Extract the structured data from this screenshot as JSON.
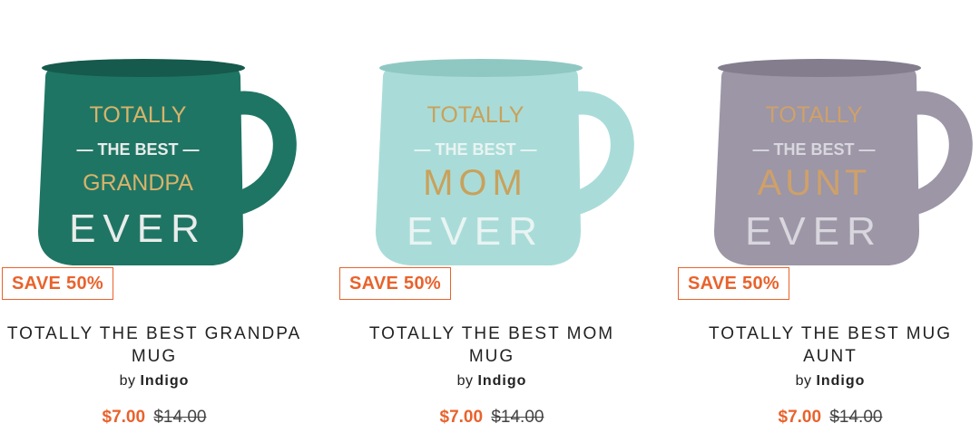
{
  "products": [
    {
      "badge": "SAVE 50%",
      "title_line1": "TOTALLY THE BEST GRANDPA",
      "title_line2": "MUG",
      "by": "by",
      "brand": "Indigo",
      "sale_price": "$7.00",
      "original_price": "$14.00",
      "mug": {
        "color": "#1f7564",
        "shade": "#155a4c",
        "words": [
          "TOTALLY",
          "— THE BEST —",
          "GRANDPA",
          "EVER"
        ],
        "accent": "#d9b36a",
        "light": "#e8ecea"
      }
    },
    {
      "badge": "SAVE 50%",
      "title_line1": "TOTALLY THE BEST MOM",
      "title_line2": "MUG",
      "by": "by",
      "brand": "Indigo",
      "sale_price": "$7.00",
      "original_price": "$14.00",
      "mug": {
        "color": "#a9dcd8",
        "shade": "#8fc8c3",
        "words": [
          "TOTALLY",
          "— THE BEST —",
          "MOM",
          "EVER"
        ],
        "accent": "#c9a15b",
        "light": "#e9f4f3"
      }
    },
    {
      "badge": "SAVE 50%",
      "title_line1": "TOTALLY THE BEST MUG",
      "title_line2": "AUNT",
      "by": "by",
      "brand": "Indigo",
      "sale_price": "$7.00",
      "original_price": "$14.00",
      "mug": {
        "color": "#9c96a6",
        "shade": "#837d8e",
        "words": [
          "TOTALLY",
          "— THE BEST —",
          "AUNT",
          "EVER"
        ],
        "accent": "#cfa06a",
        "light": "#d9d6de"
      }
    }
  ]
}
